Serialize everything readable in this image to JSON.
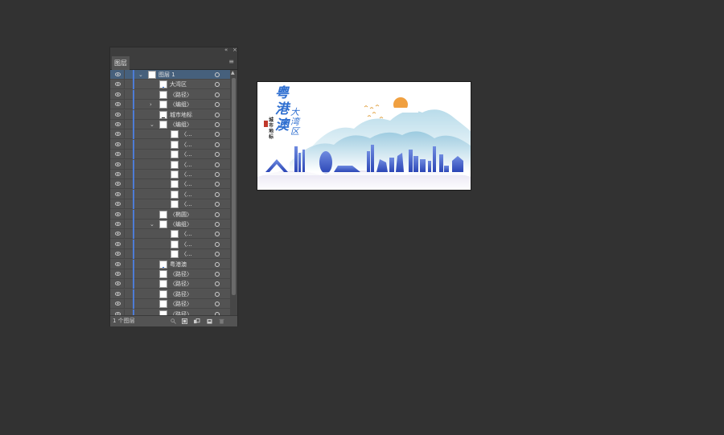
{
  "panel": {
    "collapse_glyph": "«",
    "close_glyph": "×",
    "tab_label": "图层",
    "menu_icon": "hamburger-icon",
    "footer_count": "1 个图层",
    "footer_icons": [
      "search-icon",
      "collect-export-icon",
      "make-clip-mask-icon",
      "new-sublayer-icon",
      "new-layer-icon",
      "trash-icon"
    ]
  },
  "layers": [
    {
      "name": "图层 1",
      "level": 0,
      "expanded": true,
      "selected": true,
      "thumb": "layer"
    },
    {
      "name": "大湾区",
      "level": 1,
      "thumb": "blue"
    },
    {
      "name": "〈路径〉",
      "level": 1,
      "thumb": "white"
    },
    {
      "name": "〈编组〉",
      "level": 1,
      "collapsed": true,
      "thumb": "line"
    },
    {
      "name": "城市地标",
      "level": 1,
      "thumb": "dark"
    },
    {
      "name": "〈编组〉",
      "level": 1,
      "expanded": true,
      "thumb": "white"
    },
    {
      "name": "〈...",
      "level": 2,
      "thumb": "bird"
    },
    {
      "name": "〈...",
      "level": 2,
      "thumb": "white"
    },
    {
      "name": "〈...",
      "level": 2,
      "thumb": "bird"
    },
    {
      "name": "〈...",
      "level": 2,
      "thumb": "bird"
    },
    {
      "name": "〈...",
      "level": 2,
      "thumb": "bird"
    },
    {
      "name": "〈...",
      "level": 2,
      "thumb": "bird"
    },
    {
      "name": "〈...",
      "level": 2,
      "thumb": "bird"
    },
    {
      "name": "〈...",
      "level": 2,
      "thumb": "bird"
    },
    {
      "name": "〈椭圆〉",
      "level": 1,
      "thumb": "sun"
    },
    {
      "name": "〈编组〉",
      "level": 1,
      "expanded": true,
      "thumb": "red"
    },
    {
      "name": "〈...",
      "level": 2,
      "thumb": "red"
    },
    {
      "name": "〈...",
      "level": 2,
      "thumb": "red"
    },
    {
      "name": "〈...",
      "level": 2,
      "thumb": "red"
    },
    {
      "name": "粤港澳",
      "level": 1,
      "thumb": "blue"
    },
    {
      "name": "〈路径〉",
      "level": 1,
      "thumb": "line"
    },
    {
      "name": "〈路径〉",
      "level": 1,
      "thumb": "white"
    },
    {
      "name": "〈路径〉",
      "level": 1,
      "thumb": "white"
    },
    {
      "name": "〈路径〉",
      "level": 1,
      "thumb": "white"
    },
    {
      "name": "〈路径〉",
      "level": 1,
      "thumb": "white"
    }
  ],
  "artboard": {
    "title_main": "粤港澳",
    "title_sub": "大湾区",
    "title_small": "城市地标",
    "colors": {
      "blue": "#2f6fd0",
      "mountain": "#a9d4e6",
      "sun": "#f0a040",
      "cloud": "#d9d4ea"
    }
  }
}
